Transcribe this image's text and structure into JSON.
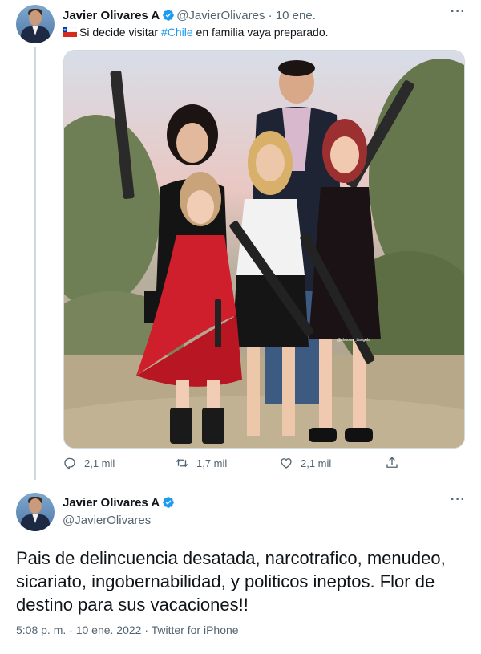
{
  "reply_tweet": {
    "display_name": "Javier Olivares A",
    "handle": "@JavierOlivares",
    "separator": "·",
    "date": "10 ene.",
    "text_prefix": "Si decide visitar ",
    "hashtag": "#Chile",
    "text_suffix": " en familia vaya preparado.",
    "flag_icon": "chile-flag-icon",
    "image_watermark": "@shooter_tiangela",
    "actions": {
      "reply_count": "2,1 mil",
      "retweet_count": "1,7 mil",
      "like_count": "2,1 mil"
    }
  },
  "main_tweet": {
    "display_name": "Javier Olivares A",
    "handle": "@JavierOlivares",
    "text": "Pais de delincuencia desatada, narcotrafico, menudeo, sicariato, ingobernabilidad, y politicos ineptos. Flor de destino para sus vacaciones!!",
    "timestamp": "5:08 p. m. · 10 ene. 2022 · Twitter for iPhone"
  },
  "colors": {
    "accent": "#1d9bf0",
    "text": "#0f1419",
    "muted": "#536471",
    "border": "#cfd9de"
  },
  "icons": [
    "verified-badge-icon",
    "more-options-icon",
    "reply-icon",
    "retweet-icon",
    "like-icon",
    "share-icon"
  ]
}
